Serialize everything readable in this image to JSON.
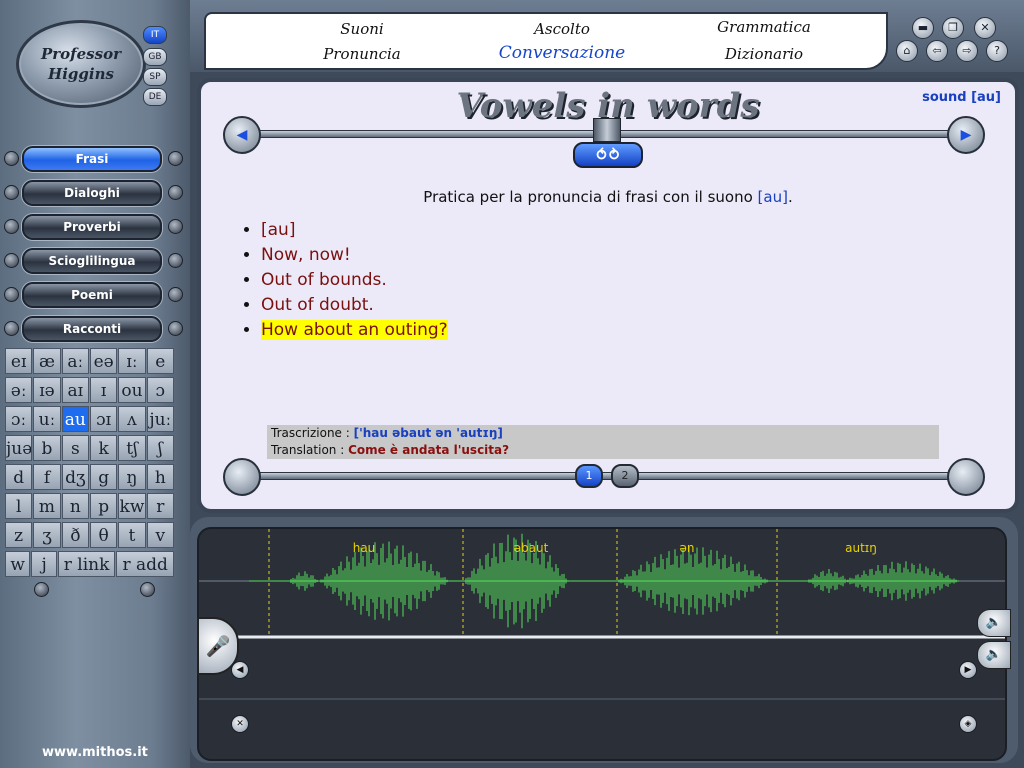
{
  "logo": {
    "line1": "Professor",
    "line2": "Higgins"
  },
  "languages": [
    {
      "code": "IT",
      "active": true
    },
    {
      "code": "GB",
      "active": false
    },
    {
      "code": "SP",
      "active": false
    },
    {
      "code": "DE",
      "active": false
    }
  ],
  "nav": [
    {
      "label": "Frasi",
      "active": true
    },
    {
      "label": "Dialoghi",
      "active": false
    },
    {
      "label": "Proverbi",
      "active": false
    },
    {
      "label": "Scioglilingua",
      "active": false
    },
    {
      "label": "Poemi",
      "active": false
    },
    {
      "label": "Racconti",
      "active": false
    }
  ],
  "phonemes": [
    [
      "eɪ",
      "æ",
      "aː",
      "eə",
      "ɪː",
      "e"
    ],
    [
      "əː",
      "ɪə",
      "aɪ",
      "ɪ",
      "ou",
      "ɔ"
    ],
    [
      "ɔː",
      "uː",
      "au",
      "ɔɪ",
      "ʌ",
      "juː"
    ],
    [
      "juə",
      "b",
      "s",
      "k",
      "tʃ",
      "ʃ"
    ],
    [
      "d",
      "f",
      "dʒ",
      "g",
      "ŋ",
      "h"
    ],
    [
      "l",
      "m",
      "n",
      "p",
      "kw",
      "r"
    ],
    [
      "z",
      "ʒ",
      "ð",
      "θ",
      "t",
      "v"
    ],
    [
      "w",
      "j",
      "r link",
      "r add"
    ]
  ],
  "phoneme_active": "au",
  "site": "www.mithos.it",
  "menu": {
    "row1": [
      "Suoni",
      "Ascolto",
      "Grammatica"
    ],
    "row2": [
      "Pronuncia",
      "Conversazione",
      "Dizionario"
    ],
    "active": "Conversazione"
  },
  "content": {
    "title": "Vowels in words",
    "sound_tag": "sound [au]",
    "instruction_prefix": "Pratica per la pronuncia di frasi con il suono ",
    "instruction_sound": "[au]",
    "instruction_suffix": ".",
    "items": [
      "[au]",
      "Now, now!",
      "Out of bounds.",
      "Out of doubt.",
      "How about an outing?"
    ],
    "highlighted_index": 4,
    "transcription_label": "Trascrizione : ",
    "transcription_value": "['hau əbaut ən 'autɪŋ]",
    "translation_label": "Translation : ",
    "translation_value": "Come è andata l'uscita?",
    "pages": [
      "1",
      "2"
    ],
    "current_page": "1"
  },
  "waveform": {
    "segments": [
      "hau",
      "əbaut",
      "ən",
      "autɪŋ"
    ],
    "wave_color": "#54e05a",
    "marker_color": "#e8d000"
  },
  "colors": {
    "accent": "#1e6df0",
    "highlight": "#ffff00",
    "item_text": "#7a1010"
  }
}
